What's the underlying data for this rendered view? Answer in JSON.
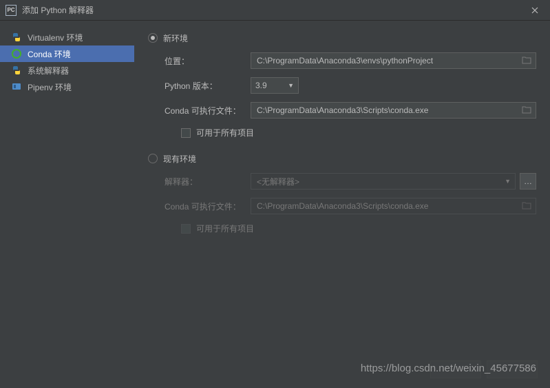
{
  "window": {
    "title": "添加 Python 解释器",
    "app_icon_text": "PC"
  },
  "sidebar": {
    "items": [
      {
        "label": "Virtualenv 环境"
      },
      {
        "label": "Conda 环境"
      },
      {
        "label": "系统解释器"
      },
      {
        "label": "Pipenv 环境"
      }
    ],
    "selected_index": 1
  },
  "form": {
    "new_env": {
      "radio_label": "新环境",
      "location_label": "位置：",
      "location_value": "C:\\ProgramData\\Anaconda3\\envs\\pythonProject",
      "python_version_label": "Python 版本：",
      "python_version_value": "3.9",
      "conda_exe_label": "Conda 可执行文件：",
      "conda_exe_value": "C:\\ProgramData\\Anaconda3\\Scripts\\conda.exe",
      "make_available_label": "可用于所有项目"
    },
    "existing_env": {
      "radio_label": "现有环境",
      "interpreter_label": "解释器：",
      "interpreter_value": "<无解释器>",
      "conda_exe_label": "Conda 可执行文件：",
      "conda_exe_value": "C:\\ProgramData\\Anaconda3\\Scripts\\conda.exe",
      "make_available_label": "可用于所有项目"
    }
  },
  "watermark": "https://blog.csdn.net/weixin_45677586"
}
